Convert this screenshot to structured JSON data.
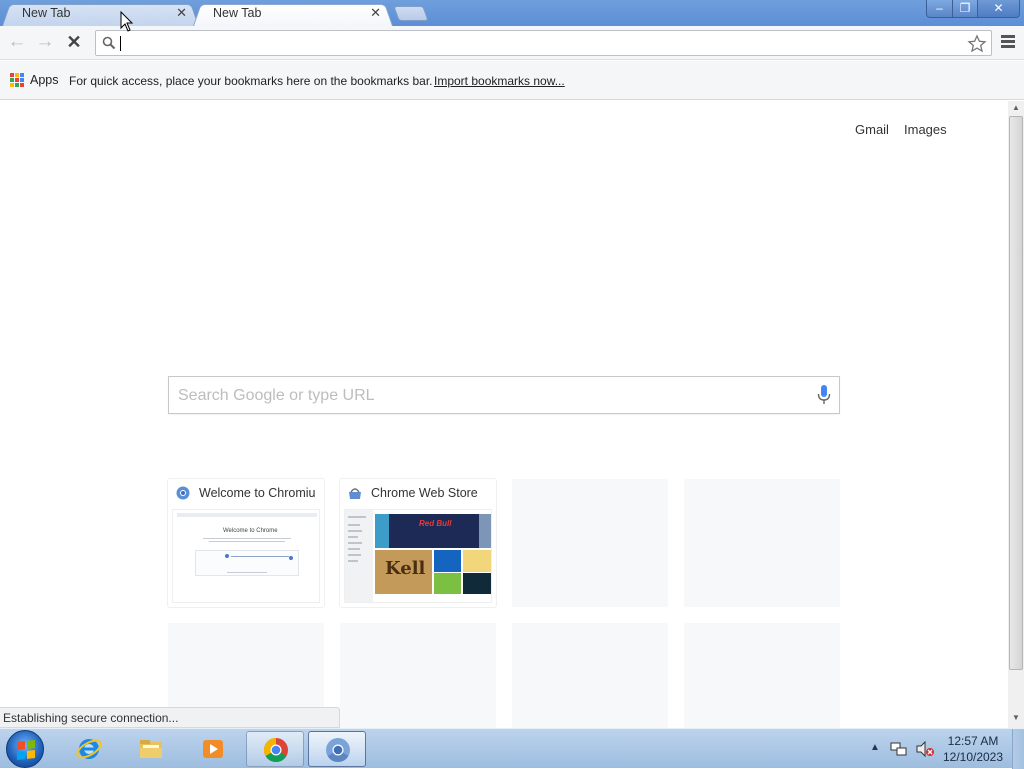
{
  "browser": {
    "tabs": [
      {
        "title": "New Tab",
        "active": false
      },
      {
        "title": "New Tab",
        "active": true
      }
    ],
    "window_controls": {
      "minimize": "–",
      "maximize": "❐",
      "close": "✕"
    },
    "toolbar": {
      "back": "←",
      "forward": "→",
      "stop": "✕",
      "omnibox_value": ""
    },
    "bookmarks_bar": {
      "apps_label": "Apps",
      "hint": "For quick access, place your bookmarks here on the bookmarks bar.",
      "import_link": "Import bookmarks now..."
    }
  },
  "new_tab_page": {
    "header_links": {
      "gmail": "Gmail",
      "images": "Images"
    },
    "search_placeholder": "Search Google or type URL",
    "most_visited": [
      {
        "title": "Welcome to Chromium",
        "thumb_title": "Welcome to Chrome"
      },
      {
        "title": "Chrome Web Store",
        "thumb_text": "Red Bull",
        "thumb_game": "Kell"
      }
    ]
  },
  "status_bubble": "Establishing secure connection...",
  "taskbar": {
    "apps": [
      "internet-explorer",
      "file-explorer",
      "media-player",
      "chrome",
      "chromium"
    ],
    "clock_time": "12:57 AM",
    "clock_date": "12/10/2023"
  },
  "colors": {
    "titlebar": "#5c8ed6",
    "google_blue": "#4285f4",
    "google_red": "#ea4335",
    "google_yellow": "#fbbc05",
    "google_green": "#34a853"
  }
}
